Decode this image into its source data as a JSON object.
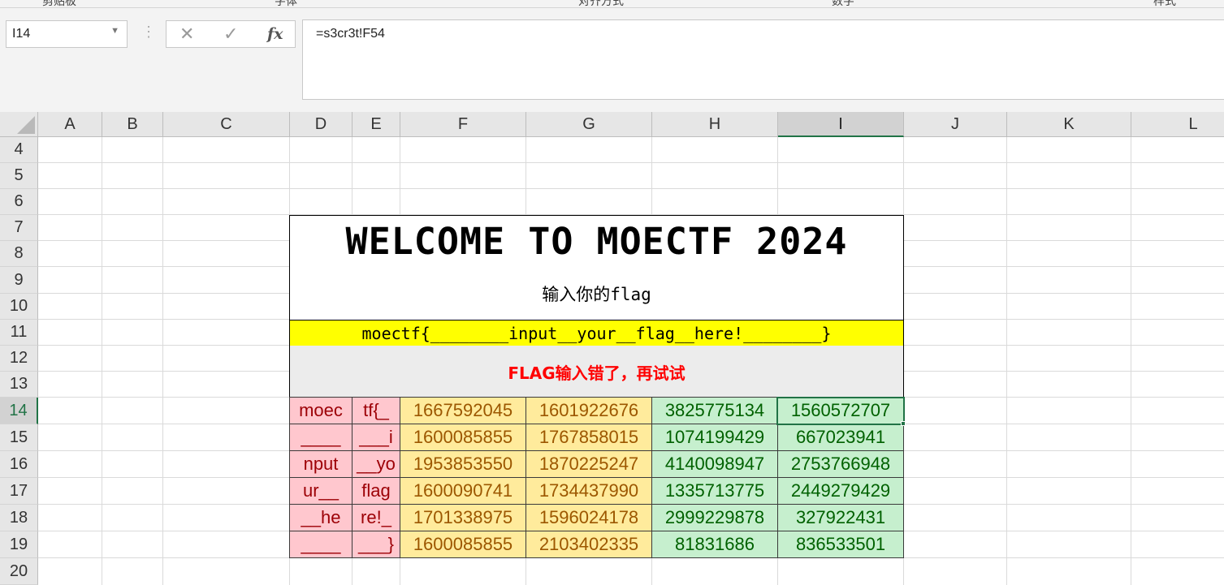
{
  "ribbon": {
    "labels": [
      "剪贴板",
      "字体",
      "对齐方式",
      "数字",
      "样式"
    ]
  },
  "formula_bar": {
    "name_box": "I14",
    "formula": "=s3cr3t!F54",
    "icons": [
      "cancel-icon",
      "enter-icon",
      "fx-icon"
    ]
  },
  "columns": [
    "A",
    "B",
    "C",
    "D",
    "E",
    "F",
    "G",
    "H",
    "I",
    "J",
    "K",
    "L"
  ],
  "selected_column": "I",
  "rows": [
    "4",
    "5",
    "6",
    "7",
    "8",
    "9",
    "10",
    "11",
    "12",
    "13",
    "14",
    "15",
    "16",
    "17",
    "18",
    "19",
    "20"
  ],
  "selected_row": "14",
  "sheet": {
    "title": "WELCOME TO MOECTF 2024",
    "prompt": "输入你的flag",
    "flag_input": "moectf{________input__your__flag__here!________}",
    "result": "FLAG输入错了，再试试"
  },
  "table": {
    "rows": [
      [
        "moec",
        "tf{_",
        "1667592045",
        "1601922676",
        "3825775134",
        "1560572707"
      ],
      [
        "____",
        "___i",
        "1600085855",
        "1767858015",
        "1074199429",
        "667023941"
      ],
      [
        "nput",
        "__yo",
        "1953853550",
        "1870225247",
        "4140098947",
        "2753766948"
      ],
      [
        "ur__",
        "flag",
        "1600090741",
        "1734437990",
        "1335713775",
        "2449279429"
      ],
      [
        "__he",
        "re!_",
        "1701338975",
        "1596024178",
        "2999229878",
        "327922431"
      ],
      [
        "____",
        "___}",
        "1600085855",
        "2103402335",
        "81831686",
        "836533501"
      ]
    ],
    "colors": {
      "pink_fill": "#ffc7ce",
      "pink_text": "#9c0006",
      "yellow_fill": "#ffeb9c",
      "yellow_text": "#9c5700",
      "green_fill": "#c6efce",
      "green_text": "#006100"
    }
  },
  "accent": "#217346"
}
